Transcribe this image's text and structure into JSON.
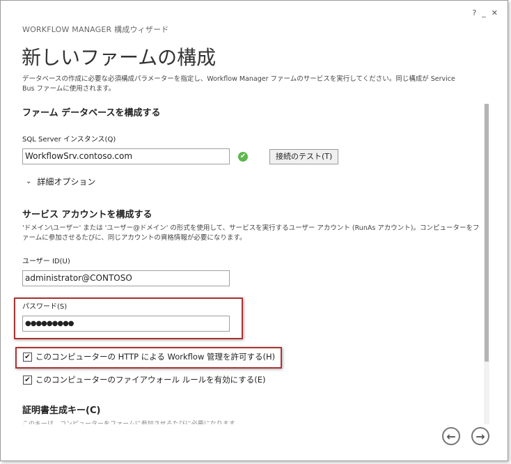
{
  "window": {
    "help": "?",
    "minimize": "_",
    "close": "✕",
    "app_title": "WORKFLOW MANAGER 構成ウィザード",
    "page_title": "新しいファームの構成",
    "intro": "データベースの作成に必要な必須構成パラメーターを指定し、Workflow Manager ファームのサービスを実行してください。同じ構成が Service Bus ファームに使用されます。"
  },
  "db_section": {
    "heading": "ファーム データベースを構成する",
    "sql_label": "SQL Server インスタンス(Q)",
    "sql_value": "WorkflowSrv.contoso.com",
    "status_icon": "✔",
    "test_button": "接続のテスト(T)",
    "advanced_icon": "⌄",
    "advanced_label": "詳細オプション"
  },
  "account_section": {
    "heading": "サービス アカウントを構成する",
    "description": "'ドメイン\\ユーザー' または 'ユーザー@ドメイン' の形式を使用して、サービスを実行するユーザー アカウント (RunAs アカウント)。コンピューターをファームに参加させるたびに、同じアカウントの資格情報が必要になります。",
    "user_label": "ユーザー ID(U)",
    "user_value": "administrator@CONTOSO",
    "password_label": "パスワード(S)",
    "password_value": "●●●●●●●●●"
  },
  "checkboxes": [
    {
      "label": "このコンピューターの HTTP による Workflow 管理を許可する(H)",
      "mark": "✔"
    },
    {
      "label": "このコンピューターのファイアウォール ルールを有効にする(E)",
      "mark": "✔"
    }
  ],
  "cert_section": {
    "heading": "証明書生成キー(C)",
    "description": "このキーは、コンピューターをファームに参加させるたびに必要になります。"
  },
  "nav": {
    "back_icon": "←",
    "next_icon": "→"
  }
}
